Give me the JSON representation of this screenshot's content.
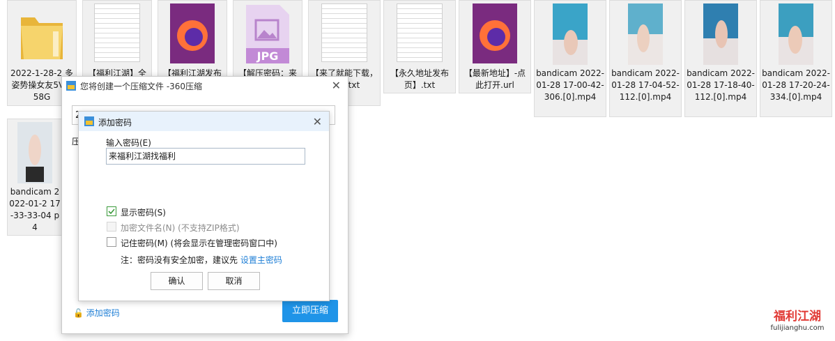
{
  "files": [
    {
      "id": "folder",
      "type": "folder",
      "name": "2022-1-28-2 多姿势操女友5V1.58G"
    },
    {
      "id": "txt1",
      "type": "txt",
      "name": "【福利江湖】全"
    },
    {
      "id": "ff1",
      "type": "firefox",
      "name": "【福利江湖发布"
    },
    {
      "id": "jpg",
      "type": "jpg",
      "name": "【解压密码：来",
      "badge": "JPG"
    },
    {
      "id": "txt2",
      "type": "txt",
      "name": "【来了就能下载，纯免.txt"
    },
    {
      "id": "txt3",
      "type": "txt",
      "name": "【永久地址发布页】.txt"
    },
    {
      "id": "ff2",
      "type": "firefox",
      "name": "【最新地址】-点此打开.url"
    },
    {
      "id": "v1",
      "type": "video",
      "name": "bandicam 2022-01-28 17-00-42-306.[0].mp4"
    },
    {
      "id": "v2",
      "type": "video",
      "name": "bandicam 2022-01-28 17-04-52-112.[0].mp4"
    },
    {
      "id": "v3",
      "type": "video",
      "name": "bandicam 2022-01-28 17-18-40-112.[0].mp4"
    },
    {
      "id": "v4",
      "type": "video",
      "name": "bandicam 2022-01-28 17-20-24-334.[0].mp4"
    },
    {
      "id": "v5",
      "type": "video",
      "name": "bandicam 2022-01-2 17-33-33-04 p4"
    }
  ],
  "compress_dialog": {
    "title": "您将创建一个压缩文件 -360压缩",
    "path_value": "2",
    "left_label": "压",
    "add_password_link": "添加密码",
    "compress_button": "立即压缩"
  },
  "password_dialog": {
    "title": "添加密码",
    "prompt": "输入密码(E)",
    "password_value": "来福利江湖找福利",
    "show_password_label": "显示密码(S)",
    "encrypt_names_label": "加密文件名(N) (不支持ZIP格式)",
    "remember_label": "记住密码(M) (将会显示在管理密码窗口中)",
    "note_text": "注：密码没有安全加密，建议先",
    "note_link": "设置主密码",
    "ok_button": "确认",
    "cancel_button": "取消"
  },
  "watermark": {
    "logo_text": "福利江湖",
    "domain": "fulijianghu.com"
  },
  "colors": {
    "accent": "#1f94e8",
    "folder": "#f3c955",
    "jpg": "#c28ad6",
    "firefox_bg": "#7a2b7f"
  }
}
